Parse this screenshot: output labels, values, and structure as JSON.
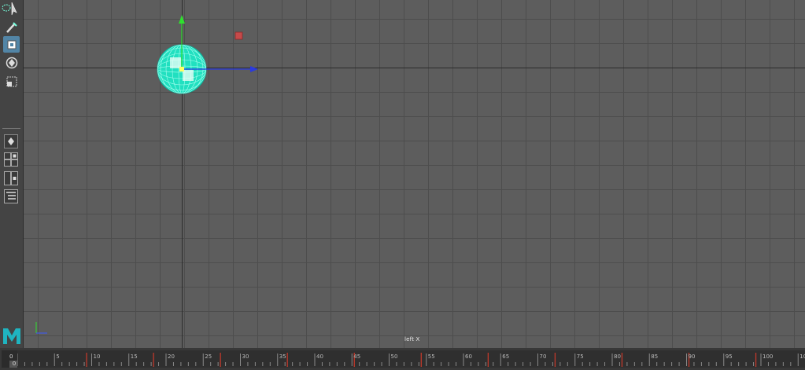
{
  "toolbox": {
    "tools": [
      {
        "name": "select-tool-icon",
        "active": false
      },
      {
        "name": "lasso-tool-icon",
        "active": false
      },
      {
        "name": "paint-select-tool-icon",
        "active": false
      },
      {
        "name": "move-tool-icon",
        "active": true
      },
      {
        "name": "rotate-tool-icon",
        "active": false
      },
      {
        "name": "scale-tool-icon",
        "active": false
      }
    ],
    "layouts": [
      "single-perspective-layout-icon",
      "four-view-layout-icon",
      "side-by-side-layout-icon",
      "outliner-layout-icon"
    ],
    "logo_text": "M",
    "logo_color": "#1fb4c0"
  },
  "viewport": {
    "camera_label": "left X",
    "grid_color": "#4d4d4d",
    "background_color": "#5d5d5d",
    "selected_object_color": "#21e0c0"
  },
  "timeline": {
    "current_frame": "0",
    "current_frame_field": "0",
    "tick_labels": [
      "5",
      "10",
      "15",
      "20",
      "25",
      "30",
      "35",
      "40",
      "45",
      "50",
      "55",
      "60",
      "65",
      "70",
      "75",
      "80",
      "85",
      "90",
      "95",
      "100",
      "105"
    ],
    "key_color": "#c0392b"
  }
}
